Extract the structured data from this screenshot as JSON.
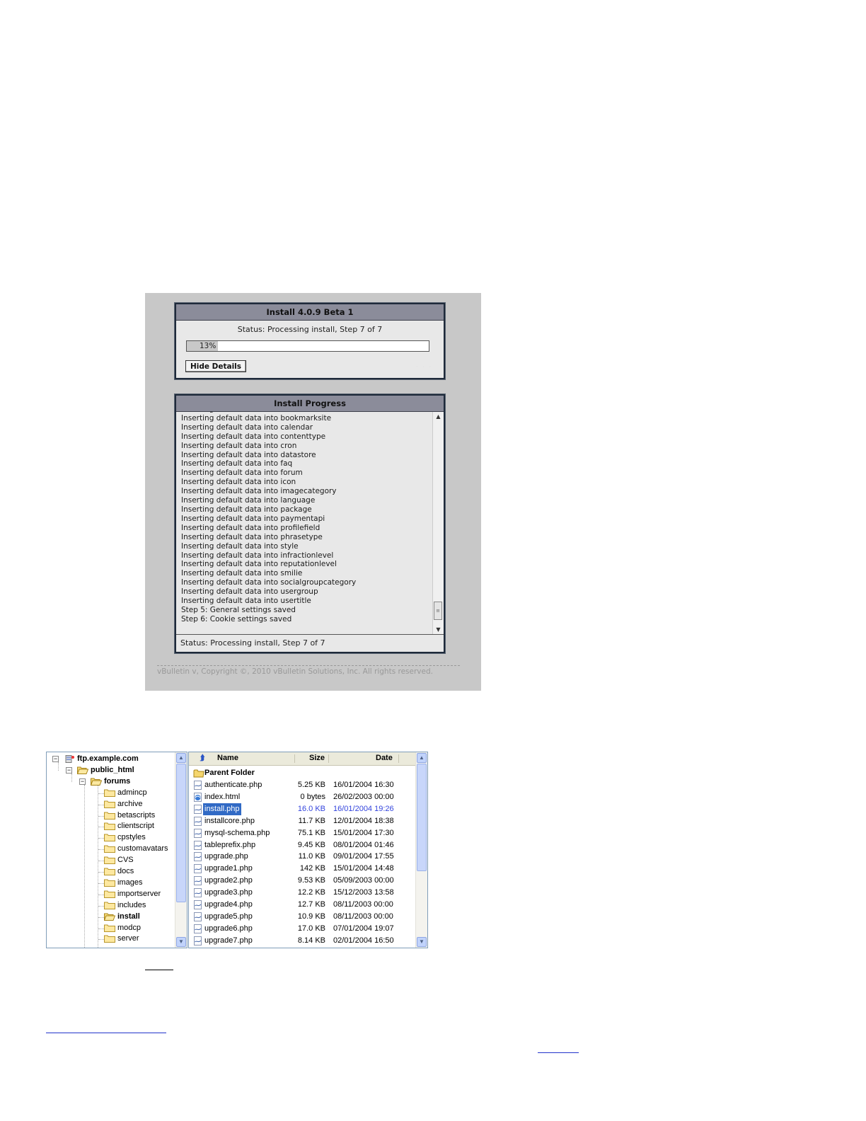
{
  "installer": {
    "title": "Install 4.0.9 Beta 1",
    "status": "Status: Processing install, Step 7 of 7",
    "progress_label": "13%",
    "progress_fraction": 0.13,
    "hide_details_button": "Hide Details",
    "progress_panel_title": "Install Progress",
    "log_lines": [
      "Inserting default data into datastore",
      "Inserting default data into bookmarksite",
      "Inserting default data into calendar",
      "Inserting default data into contenttype",
      "Inserting default data into cron",
      "Inserting default data into datastore",
      "Inserting default data into faq",
      "Inserting default data into forum",
      "Inserting default data into icon",
      "Inserting default data into imagecategory",
      "Inserting default data into language",
      "Inserting default data into package",
      "Inserting default data into paymentapi",
      "Inserting default data into profilefield",
      "Inserting default data into phrasetype",
      "Inserting default data into style",
      "Inserting default data into infractionlevel",
      "Inserting default data into reputationlevel",
      "Inserting default data into smilie",
      "Inserting default data into socialgroupcategory",
      "Inserting default data into usergroup",
      "Inserting default data into usertitle",
      "Step 5: General settings saved",
      "Step 6: Cookie settings saved"
    ],
    "footer_status": "Status: Processing install, Step 7 of 7",
    "copyright": "vBulletin v, Copyright ©, 2010 vBulletin Solutions, Inc. All rights reserved."
  },
  "ftp": {
    "tree": [
      {
        "label": "ftp.example.com",
        "bold": true
      },
      {
        "label": "public_html",
        "bold": true
      },
      {
        "label": "forums",
        "bold": true
      },
      {
        "label": "admincp"
      },
      {
        "label": "archive"
      },
      {
        "label": "betascripts"
      },
      {
        "label": "clientscript"
      },
      {
        "label": "cpstyles"
      },
      {
        "label": "customavatars"
      },
      {
        "label": "CVS"
      },
      {
        "label": "docs"
      },
      {
        "label": "images"
      },
      {
        "label": "importserver"
      },
      {
        "label": "includes"
      },
      {
        "label": "install",
        "bold": true
      },
      {
        "label": "modcp"
      },
      {
        "label": "server"
      }
    ],
    "columns": {
      "name": "Name",
      "size": "Size",
      "date": "Date"
    },
    "parent_folder": "Parent Folder",
    "files": [
      {
        "name": "authenticate.php",
        "size": "5.25 KB",
        "date": "16/01/2004 16:30"
      },
      {
        "name": "index.html",
        "size": "0 bytes",
        "date": "26/02/2003 00:00"
      },
      {
        "name": "install.php",
        "size": "16.0 KB",
        "date": "16/01/2004 19:26"
      },
      {
        "name": "installcore.php",
        "size": "11.7 KB",
        "date": "12/01/2004 18:38"
      },
      {
        "name": "mysql-schema.php",
        "size": "75.1 KB",
        "date": "15/01/2004 17:30"
      },
      {
        "name": "tableprefix.php",
        "size": "9.45 KB",
        "date": "08/01/2004 01:46"
      },
      {
        "name": "upgrade.php",
        "size": "11.0 KB",
        "date": "09/01/2004 17:55"
      },
      {
        "name": "upgrade1.php",
        "size": "142 KB",
        "date": "15/01/2004 14:48"
      },
      {
        "name": "upgrade2.php",
        "size": "9.53 KB",
        "date": "05/09/2003 00:00"
      },
      {
        "name": "upgrade3.php",
        "size": "12.2 KB",
        "date": "15/12/2003 13:58"
      },
      {
        "name": "upgrade4.php",
        "size": "12.7 KB",
        "date": "08/11/2003 00:00"
      },
      {
        "name": "upgrade5.php",
        "size": "10.9 KB",
        "date": "08/11/2003 00:00"
      },
      {
        "name": "upgrade6.php",
        "size": "17.0 KB",
        "date": "07/01/2004 19:07"
      },
      {
        "name": "upgrade7.php",
        "size": "8.14 KB",
        "date": "02/01/2004 16:50"
      }
    ],
    "selected_file": "install.php"
  },
  "colors": {
    "panel_bg": "#c8c8c8",
    "panel_header": "#8b8c9a",
    "selection_blue": "#316ac5"
  }
}
